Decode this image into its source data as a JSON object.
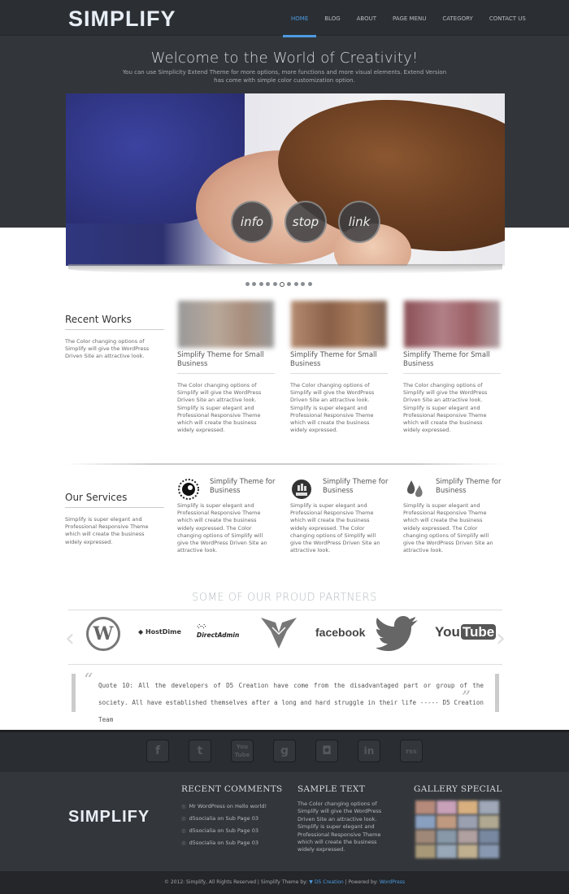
{
  "header": {
    "logo": "SIMPLIFY",
    "nav": [
      "HOME",
      "BLOG",
      "ABOUT",
      "PAGE MENU",
      "CATEGORY",
      "CONTACT US"
    ],
    "welcome": "Welcome to the World of Creativity!",
    "subline": "You can use Simplicity Extend Theme for more options, more functions and more visual elements. Extend Version has come with simple color customization option."
  },
  "slider": {
    "buttons": [
      "info",
      "stop",
      "link"
    ],
    "dots_total": 10,
    "active_dot": 6
  },
  "recent_works": {
    "title": "Recent Works",
    "text": "The Color changing options of Simplify will give the WordPress Driven Site an attractive look.",
    "items": [
      {
        "title": "Simplify Theme for Small Business",
        "text": "The Color changing options of Simplify will give the WordPress Driven Site an attractive look. Simplify is super elegant and Professional Responsive Theme which will create the business widely expressed."
      },
      {
        "title": "Simplify Theme for Small Business",
        "text": "The Color changing options of Simplify will give the WordPress Driven Site an attractive look. Simplify is super elegant and Professional Responsive Theme which will create the business widely expressed."
      },
      {
        "title": "Simplify Theme for Small Business",
        "text": "The Color changing options of Simplify will give the WordPress Driven Site an attractive look. Simplify is super elegant and Professional Responsive Theme which will create the business widely expressed."
      }
    ]
  },
  "services": {
    "title": "Our Services",
    "text": "Simplify is super elegant and Professional Responsive Theme which will create the business widely expressed.",
    "items": [
      {
        "title": "Simplify Theme for Business",
        "icon": "gear-icon",
        "text": "Simplify is super elegant and Professional Responsive Theme which will create the business widely expressed. The Color changing options of Simplify will give the WordPress Driven Site an attractive look."
      },
      {
        "title": "Simplify Theme for Business",
        "icon": "chart-icon",
        "text": "Simplify is super elegant and Professional Responsive Theme which will create the business widely expressed. The Color changing options of Simplify will give the WordPress Driven Site an attractive look."
      },
      {
        "title": "Simplify Theme for Business",
        "icon": "drops-icon",
        "text": "Simplify is super elegant and Professional Responsive Theme which will create the business widely expressed. The Color changing options of Simplify will give the WordPress Driven Site an attractive look."
      }
    ]
  },
  "partners": {
    "title": "SOME OF OUR PROUD PARTNERS",
    "logos": [
      "W",
      "HostDime",
      "DirectAdmin",
      "facebook",
      "You"
    ],
    "youtube_tube": "Tube"
  },
  "quote": {
    "text": "Quote 10: All the developers of D5 Creation have come from the disadvantaged part or group of the society. All have established themselves after a long and hard struggle in their life ----- D5 Creation Team"
  },
  "social": [
    "f",
    "t",
    "You Tube",
    "g",
    "◘",
    "in",
    "rss"
  ],
  "footer": {
    "logo": "SIMPLIFY",
    "recent_comments_title": "RECENT COMMENTS",
    "comments": [
      "Mr WordPress on Hello world!",
      "d5socialia on Sub Page 03",
      "d5socialia on Sub Page 03",
      "d5socialia on Sub Page 03"
    ],
    "sample_title": "SAMPLE TEXT",
    "sample_text": "The Color changing options of Simplify will give the WordPress Driven Site an attractive look. Simplify is super elegant and Professional Responsive Theme which will create the business widely expressed.",
    "gallery_title": "GALLERY SPECIAL",
    "copyright_prefix": "© 2012: Simplify, All Rights Reserved | Simplify Theme by:",
    "d5_link": "D5 Creation",
    "powered": "| Powered by:",
    "wp_link": "WordPress"
  }
}
